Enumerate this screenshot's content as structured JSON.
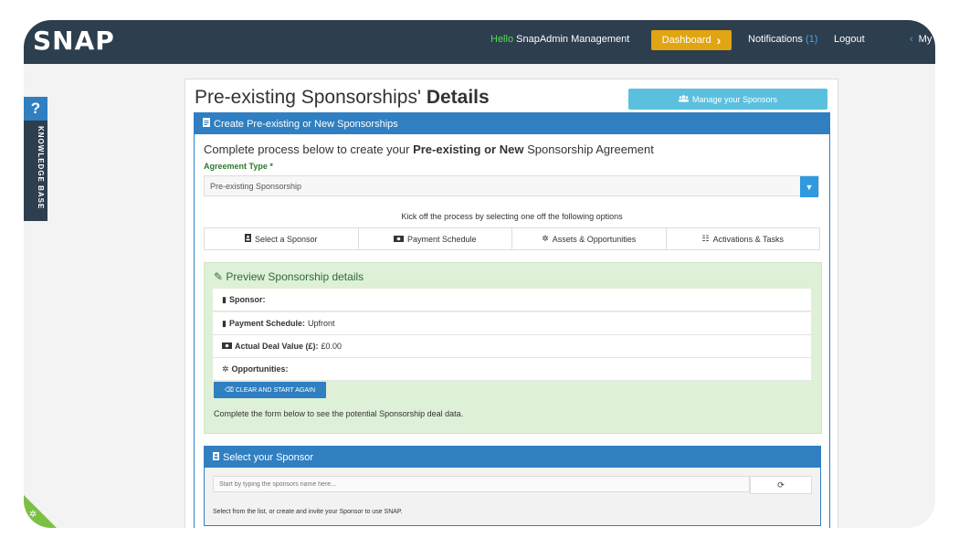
{
  "nav": {
    "logo": "SNAP",
    "hello": "Hello",
    "user": "SnapAdmin Management",
    "dashboard_label": "Dashboard",
    "dashboard_chevron": "›",
    "notifications_label": "Notifications",
    "notifications_count": "(1)",
    "logout_label": "Logout",
    "my_chevron": "‹",
    "my_label": "My"
  },
  "knowledge_base": {
    "question": "?",
    "label": "KNOWLEDGE BASE"
  },
  "page": {
    "title_normal": "Pre-existing Sponsorships'",
    "title_bold": "Details",
    "manage_label": "Manage your Sponsors"
  },
  "create_card": {
    "header": "Create Pre-existing or New Sponsorships",
    "lead_before": "Complete process below to create your",
    "lead_bold": "Pre-existing or New",
    "lead_after": "Sponsorship Agreement",
    "agreement_label": "Agreement Type *",
    "agreement_value": "Pre-existing Sponsorship",
    "kickoff": "Kick off the process by selecting one off the following options",
    "tabs": [
      {
        "label": "Select a Sponsor"
      },
      {
        "label": "Payment Schedule"
      },
      {
        "label": "Assets & Opportunities"
      },
      {
        "label": "Activations & Tasks"
      }
    ]
  },
  "preview": {
    "title": "Preview Sponsorship details",
    "sponsor_label": "Sponsor:",
    "payment_label": "Payment Schedule:",
    "payment_value": "Upfront",
    "deal_label": "Actual Deal Value (£):",
    "deal_value": "£0.00",
    "opps_label": "Opportunities:",
    "clear_label": "CLEAR AND START AGAIN",
    "note": "Complete the form below to see the potential Sponsorship deal data."
  },
  "sponsor_select": {
    "header": "Select your Sponsor",
    "placeholder": "Start by typing the sponsors name here...",
    "help": "Select from the list, or create and invite your Sponsor to use SNAP."
  },
  "colors": {
    "accent_blue": "#2f7fc1",
    "navbar": "#2d3e4e",
    "dashboard": "#e0a512",
    "preview_bg": "#dff0d8"
  }
}
